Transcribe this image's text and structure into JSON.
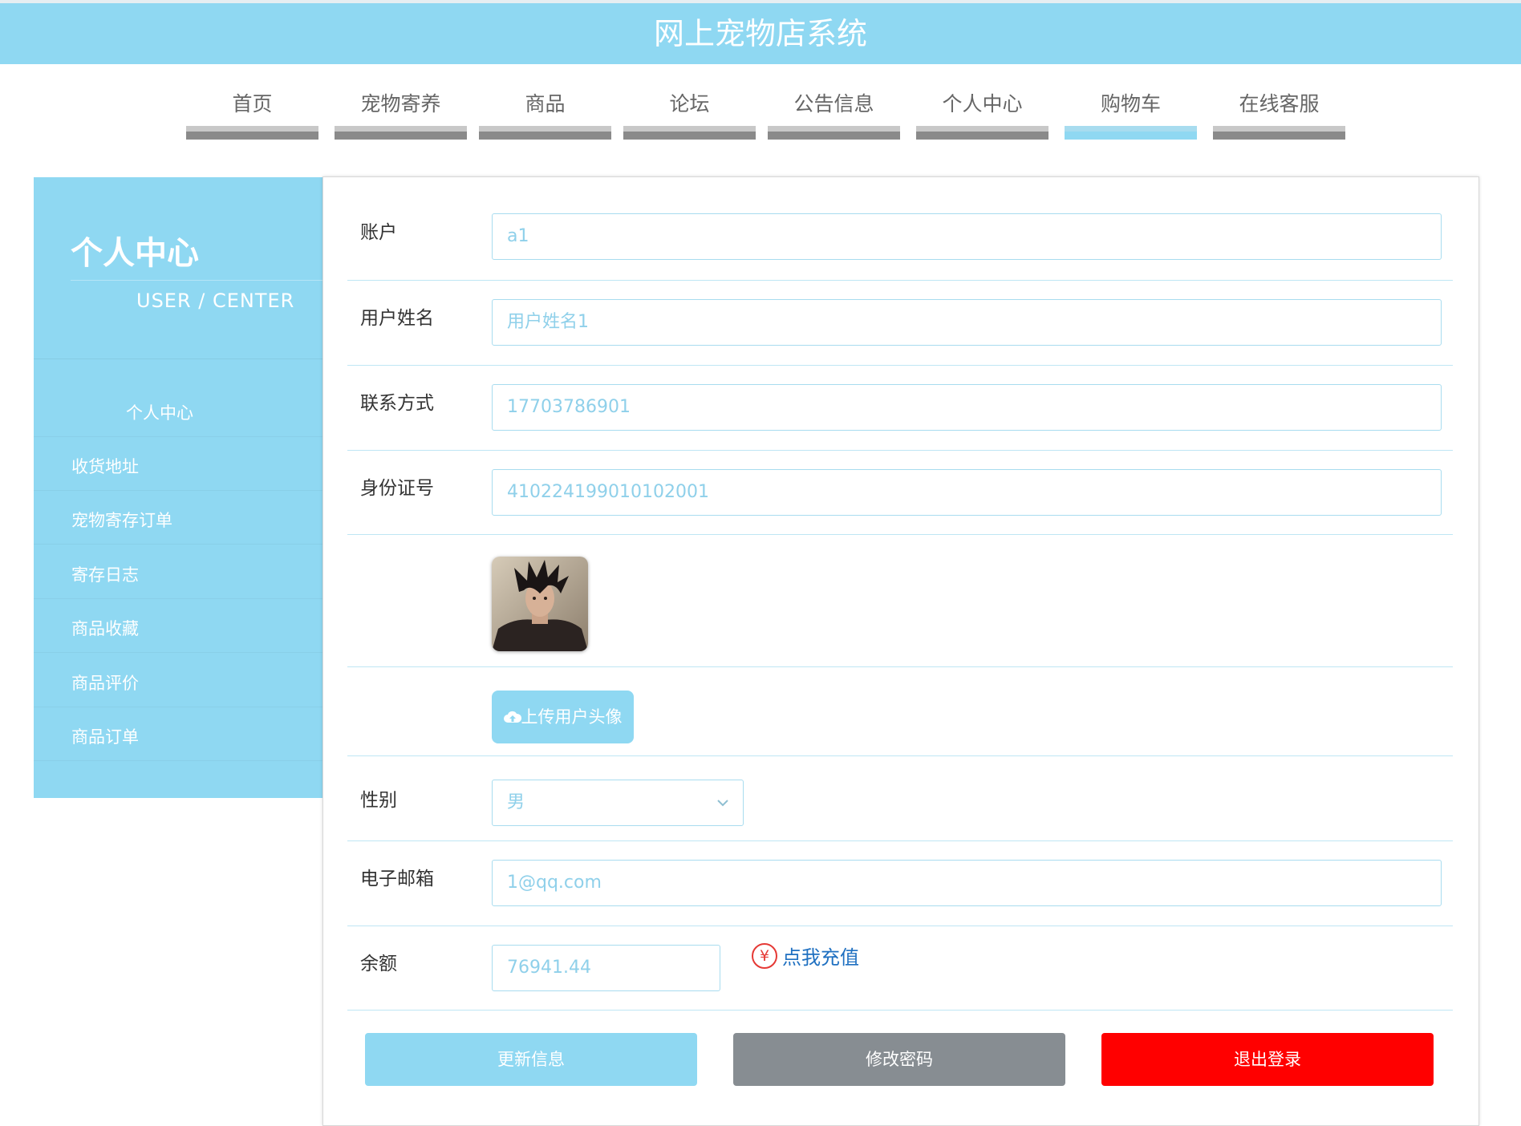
{
  "header": {
    "title": "网上宠物店系统"
  },
  "nav": [
    "首页",
    "宠物寄养",
    "商品",
    "论坛",
    "公告信息",
    "个人中心",
    "购物车",
    "在线客服"
  ],
  "sidebar": {
    "title": "个人中心",
    "subtitle": "USER / CENTER",
    "items": [
      "个人中心",
      "收货地址",
      "宠物寄存订单",
      "寄存日志",
      "商品收藏",
      "商品评价",
      "商品订单"
    ]
  },
  "form": {
    "account": {
      "label": "账户",
      "value": "a1"
    },
    "username": {
      "label": "用户姓名",
      "value": "用户姓名1"
    },
    "phone": {
      "label": "联系方式",
      "value": "17703786901"
    },
    "idcard": {
      "label": "身份证号",
      "value": "410224199010102001"
    },
    "upload_label": "上传用户头像",
    "gender": {
      "label": "性别",
      "value": "男"
    },
    "email": {
      "label": "电子邮箱",
      "value": "1@qq.com"
    },
    "balance": {
      "label": "余额",
      "value": "76941.44",
      "recharge": "点我充值"
    }
  },
  "buttons": {
    "update": "更新信息",
    "password": "修改密码",
    "logout": "退出登录"
  },
  "icons": {
    "upload": "cloud-upload-icon",
    "recharge": "yen-icon",
    "select": "chevron-down-icon"
  },
  "colors": {
    "primary": "#8fd8f2",
    "gray_button": "#878d92",
    "danger": "#ff0000",
    "link": "#1f70c1"
  }
}
